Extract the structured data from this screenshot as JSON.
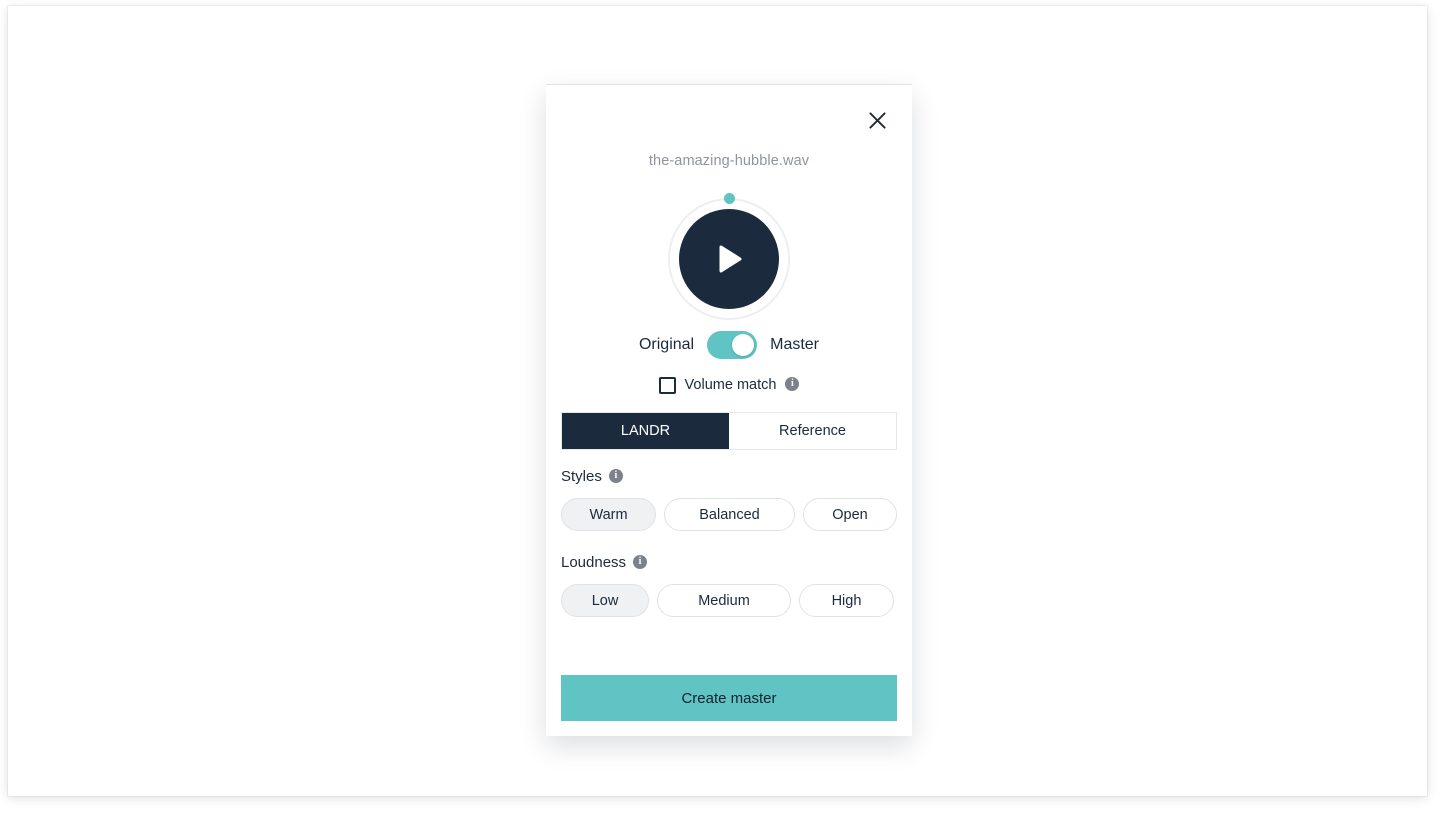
{
  "modal": {
    "close_icon": "close-icon",
    "file_name": "the-amazing-hubble.wav",
    "player": {
      "play_icon": "play-icon",
      "progress_dot": "progress-dot"
    },
    "ab_toggle": {
      "left_label": "Original",
      "right_label": "Master",
      "state": "Master"
    },
    "volume_match": {
      "label": "Volume match",
      "checked": false,
      "info_icon": "info-icon",
      "info_glyph": "i"
    },
    "tabs": [
      {
        "label": "LANDR",
        "active": true
      },
      {
        "label": "Reference",
        "active": false
      }
    ],
    "styles": {
      "label": "Styles",
      "info_glyph": "i",
      "options": [
        {
          "label": "Warm",
          "selected": true
        },
        {
          "label": "Balanced",
          "selected": false
        },
        {
          "label": "Open",
          "selected": false
        }
      ]
    },
    "loudness": {
      "label": "Loudness",
      "info_glyph": "i",
      "options": [
        {
          "label": "Low",
          "selected": true
        },
        {
          "label": "Medium",
          "selected": false
        },
        {
          "label": "High",
          "selected": false
        }
      ]
    },
    "cta_label": "Create master"
  },
  "colors": {
    "accent_teal": "#5fc4c3",
    "dark_navy": "#1b2b3d",
    "muted_text": "#8e949e",
    "pill_selected_bg": "#f0f1f3",
    "border": "#dfe2e6"
  }
}
